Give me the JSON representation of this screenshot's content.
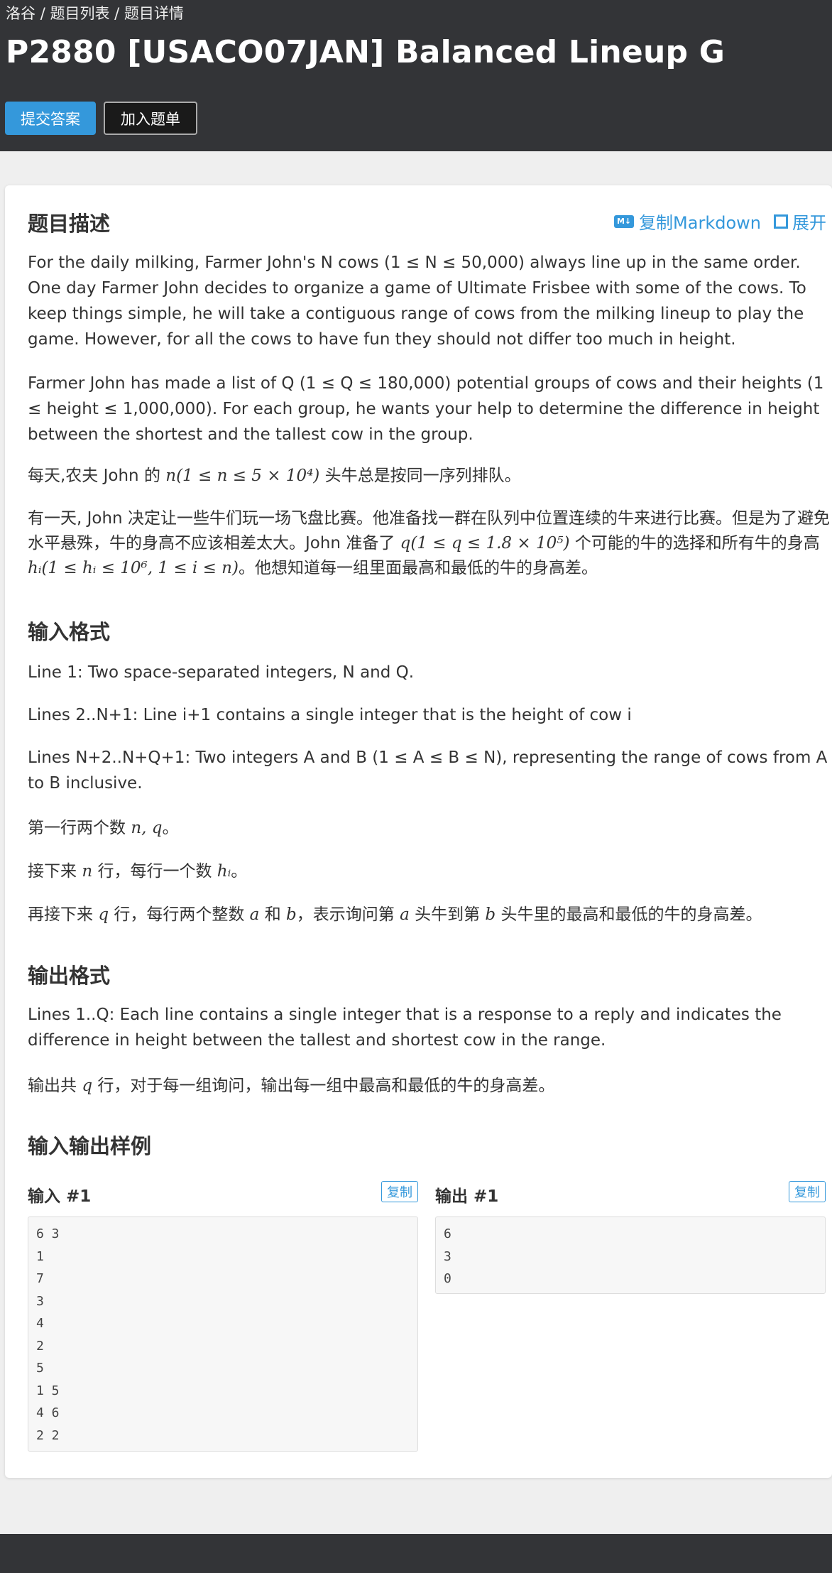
{
  "breadcrumb": {
    "home": "洛谷",
    "list": "题目列表",
    "detail": "题目详情",
    "sep": "/"
  },
  "title": "P2880 [USACO07JAN] Balanced Lineup G",
  "buttons": {
    "submit": "提交答案",
    "add_to_list": "加入题单"
  },
  "tools": {
    "copy_markdown": "复制Markdown",
    "expand": "展开",
    "md_icon": "M↓"
  },
  "description": {
    "heading": "题目描述",
    "p1": "For the daily milking, Farmer John's N cows (1 ≤ N ≤ 50,000) always line up in the same order. One day Farmer John decides to organize a game of Ultimate Frisbee with some of the cows. To keep things simple, he will take a contiguous range of cows from the milking lineup to play the game. However, for all the cows to have fun they should not differ too much in height.",
    "p2": "Farmer John has made a list of Q (1 ≤ Q ≤ 180,000) potential groups of cows and their heights (1 ≤ height ≤ 1,000,000). For each group, he wants your help to determine the difference in height between the shortest and the tallest cow in the group.",
    "p3_a": "每天,农夫 John 的 ",
    "p3_math": "n(1 ≤ n ≤ 5 × 10⁴)",
    "p3_b": " 头牛总是按同一序列排队。",
    "p4_a": "有一天, John 决定让一些牛们玩一场飞盘比赛。他准备找一群在队列中位置连续的牛来进行比赛。但是为了避免水平悬殊，牛的身高不应该相差太大。John 准备了 ",
    "p4_math1": "q(1 ≤ q ≤ 1.8 × 10⁵)",
    "p4_b": " 个可能的牛的选择和所有牛的身高 ",
    "p4_math2": "hᵢ(1 ≤ hᵢ ≤ 10⁶, 1 ≤ i ≤ n)",
    "p4_c": "。他想知道每一组里面最高和最低的牛的身高差。"
  },
  "input_format": {
    "heading": "输入格式",
    "l1": "Line 1: Two space-separated integers, N and Q.",
    "l2": "Lines 2..N+1: Line i+1 contains a single integer that is the height of cow i",
    "l3": "Lines N+2..N+Q+1: Two integers A and B (1 ≤ A ≤ B ≤ N), representing the range of cows from A to B inclusive.",
    "c1_a": "第一行两个数 ",
    "c1_math": "n, q",
    "c1_b": "。",
    "c2_a": "接下来 ",
    "c2_math": "n",
    "c2_b": " 行，每行一个数 ",
    "c2_math2": "hᵢ",
    "c2_c": "。",
    "c3_a": "再接下来 ",
    "c3_math": "q",
    "c3_b": " 行，每行两个整数 ",
    "c3_math2": "a",
    "c3_c": " 和 ",
    "c3_math3": "b",
    "c3_d": "，表示询问第 ",
    "c3_math4": "a",
    "c3_e": " 头牛到第 ",
    "c3_math5": "b",
    "c3_f": " 头牛里的最高和最低的牛的身高差。"
  },
  "output_format": {
    "heading": "输出格式",
    "l1": "Lines 1..Q: Each line contains a single integer that is a response to a reply and indicates the difference in height between the tallest and shortest cow in the range.",
    "c1_a": "输出共 ",
    "c1_math": "q",
    "c1_b": " 行，对于每一组询问，输出每一组中最高和最低的牛的身高差。"
  },
  "samples": {
    "heading": "输入输出样例",
    "input_label": "输入 #1",
    "output_label": "输出 #1",
    "copy": "复制",
    "input": "6 3\n1\n7\n3\n4\n2\n5\n1 5\n4 6\n2 2",
    "output": "6\n3\n0"
  }
}
